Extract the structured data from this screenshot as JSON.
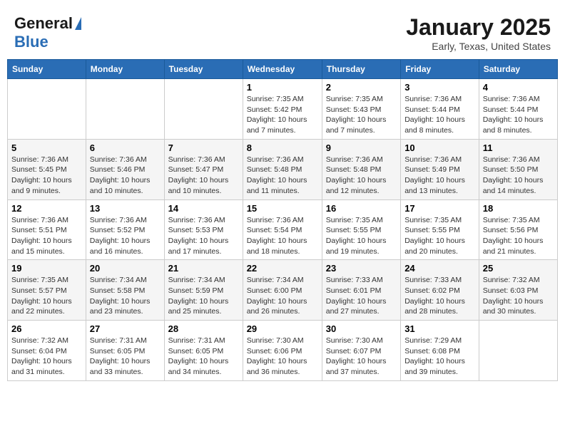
{
  "header": {
    "logo_general": "General",
    "logo_blue": "Blue",
    "title": "January 2025",
    "subtitle": "Early, Texas, United States"
  },
  "calendar": {
    "days_of_week": [
      "Sunday",
      "Monday",
      "Tuesday",
      "Wednesday",
      "Thursday",
      "Friday",
      "Saturday"
    ],
    "weeks": [
      [
        {
          "day": "",
          "info": ""
        },
        {
          "day": "",
          "info": ""
        },
        {
          "day": "",
          "info": ""
        },
        {
          "day": "1",
          "info": "Sunrise: 7:35 AM\nSunset: 5:42 PM\nDaylight: 10 hours\nand 7 minutes."
        },
        {
          "day": "2",
          "info": "Sunrise: 7:35 AM\nSunset: 5:43 PM\nDaylight: 10 hours\nand 7 minutes."
        },
        {
          "day": "3",
          "info": "Sunrise: 7:36 AM\nSunset: 5:44 PM\nDaylight: 10 hours\nand 8 minutes."
        },
        {
          "day": "4",
          "info": "Sunrise: 7:36 AM\nSunset: 5:44 PM\nDaylight: 10 hours\nand 8 minutes."
        }
      ],
      [
        {
          "day": "5",
          "info": "Sunrise: 7:36 AM\nSunset: 5:45 PM\nDaylight: 10 hours\nand 9 minutes."
        },
        {
          "day": "6",
          "info": "Sunrise: 7:36 AM\nSunset: 5:46 PM\nDaylight: 10 hours\nand 10 minutes."
        },
        {
          "day": "7",
          "info": "Sunrise: 7:36 AM\nSunset: 5:47 PM\nDaylight: 10 hours\nand 10 minutes."
        },
        {
          "day": "8",
          "info": "Sunrise: 7:36 AM\nSunset: 5:48 PM\nDaylight: 10 hours\nand 11 minutes."
        },
        {
          "day": "9",
          "info": "Sunrise: 7:36 AM\nSunset: 5:48 PM\nDaylight: 10 hours\nand 12 minutes."
        },
        {
          "day": "10",
          "info": "Sunrise: 7:36 AM\nSunset: 5:49 PM\nDaylight: 10 hours\nand 13 minutes."
        },
        {
          "day": "11",
          "info": "Sunrise: 7:36 AM\nSunset: 5:50 PM\nDaylight: 10 hours\nand 14 minutes."
        }
      ],
      [
        {
          "day": "12",
          "info": "Sunrise: 7:36 AM\nSunset: 5:51 PM\nDaylight: 10 hours\nand 15 minutes."
        },
        {
          "day": "13",
          "info": "Sunrise: 7:36 AM\nSunset: 5:52 PM\nDaylight: 10 hours\nand 16 minutes."
        },
        {
          "day": "14",
          "info": "Sunrise: 7:36 AM\nSunset: 5:53 PM\nDaylight: 10 hours\nand 17 minutes."
        },
        {
          "day": "15",
          "info": "Sunrise: 7:36 AM\nSunset: 5:54 PM\nDaylight: 10 hours\nand 18 minutes."
        },
        {
          "day": "16",
          "info": "Sunrise: 7:35 AM\nSunset: 5:55 PM\nDaylight: 10 hours\nand 19 minutes."
        },
        {
          "day": "17",
          "info": "Sunrise: 7:35 AM\nSunset: 5:55 PM\nDaylight: 10 hours\nand 20 minutes."
        },
        {
          "day": "18",
          "info": "Sunrise: 7:35 AM\nSunset: 5:56 PM\nDaylight: 10 hours\nand 21 minutes."
        }
      ],
      [
        {
          "day": "19",
          "info": "Sunrise: 7:35 AM\nSunset: 5:57 PM\nDaylight: 10 hours\nand 22 minutes."
        },
        {
          "day": "20",
          "info": "Sunrise: 7:34 AM\nSunset: 5:58 PM\nDaylight: 10 hours\nand 23 minutes."
        },
        {
          "day": "21",
          "info": "Sunrise: 7:34 AM\nSunset: 5:59 PM\nDaylight: 10 hours\nand 25 minutes."
        },
        {
          "day": "22",
          "info": "Sunrise: 7:34 AM\nSunset: 6:00 PM\nDaylight: 10 hours\nand 26 minutes."
        },
        {
          "day": "23",
          "info": "Sunrise: 7:33 AM\nSunset: 6:01 PM\nDaylight: 10 hours\nand 27 minutes."
        },
        {
          "day": "24",
          "info": "Sunrise: 7:33 AM\nSunset: 6:02 PM\nDaylight: 10 hours\nand 28 minutes."
        },
        {
          "day": "25",
          "info": "Sunrise: 7:32 AM\nSunset: 6:03 PM\nDaylight: 10 hours\nand 30 minutes."
        }
      ],
      [
        {
          "day": "26",
          "info": "Sunrise: 7:32 AM\nSunset: 6:04 PM\nDaylight: 10 hours\nand 31 minutes."
        },
        {
          "day": "27",
          "info": "Sunrise: 7:31 AM\nSunset: 6:05 PM\nDaylight: 10 hours\nand 33 minutes."
        },
        {
          "day": "28",
          "info": "Sunrise: 7:31 AM\nSunset: 6:05 PM\nDaylight: 10 hours\nand 34 minutes."
        },
        {
          "day": "29",
          "info": "Sunrise: 7:30 AM\nSunset: 6:06 PM\nDaylight: 10 hours\nand 36 minutes."
        },
        {
          "day": "30",
          "info": "Sunrise: 7:30 AM\nSunset: 6:07 PM\nDaylight: 10 hours\nand 37 minutes."
        },
        {
          "day": "31",
          "info": "Sunrise: 7:29 AM\nSunset: 6:08 PM\nDaylight: 10 hours\nand 39 minutes."
        },
        {
          "day": "",
          "info": ""
        }
      ]
    ]
  }
}
